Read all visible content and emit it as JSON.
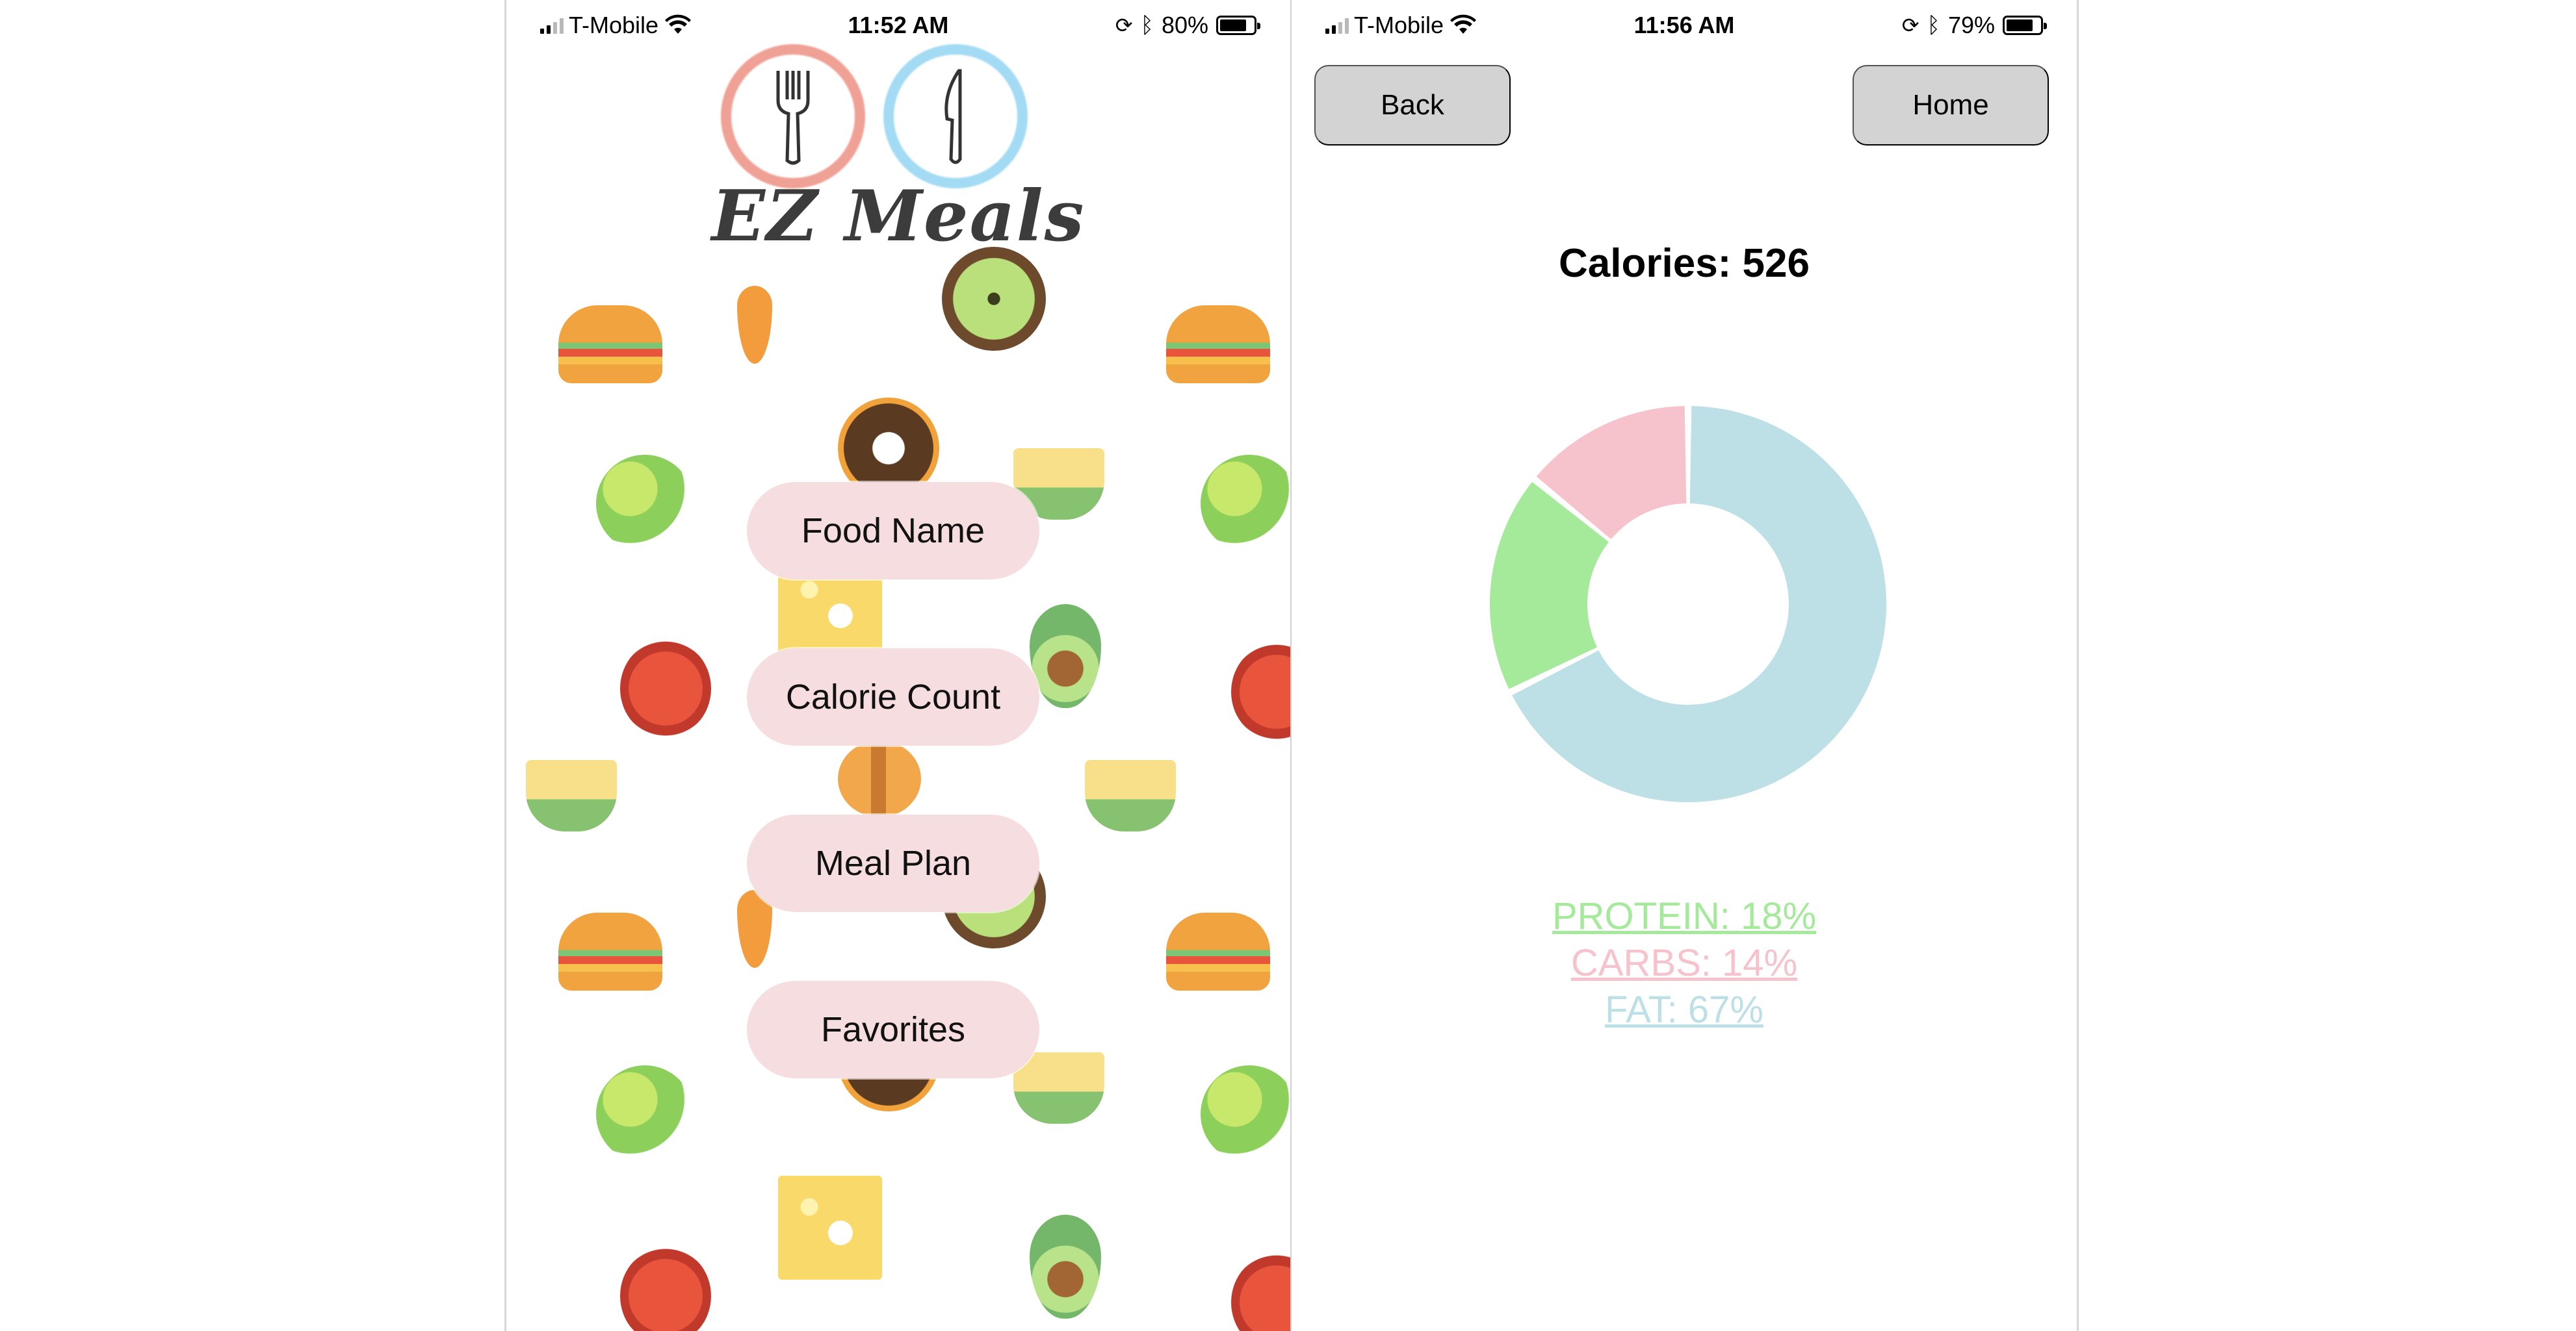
{
  "left_screen": {
    "status": {
      "carrier": "T-Mobile",
      "time": "11:52 AM",
      "battery": "80%",
      "battery_fraction": 0.8
    },
    "logo": {
      "text": "EZ Meals"
    },
    "menu": [
      {
        "label": "Food Name"
      },
      {
        "label": "Calorie Count"
      },
      {
        "label": "Meal Plan"
      },
      {
        "label": "Favorites"
      }
    ]
  },
  "right_screen": {
    "status": {
      "carrier": "T-Mobile",
      "time": "11:56 AM",
      "battery": "79%",
      "battery_fraction": 0.79
    },
    "nav": {
      "back_label": "Back",
      "home_label": "Home"
    },
    "calories_label": "Calories: 526",
    "legend": [
      {
        "text": "PROTEIN: 18%",
        "color": "#a5e99a"
      },
      {
        "text": "CARBS: 14%",
        "color": "#f6c3cc"
      },
      {
        "text": "FAT: 67%",
        "color": "#bddfe6"
      }
    ]
  },
  "chart_data": {
    "type": "pie",
    "categories": [
      "FAT",
      "PROTEIN",
      "CARBS"
    ],
    "values": [
      67,
      18,
      14
    ],
    "colors": [
      "#bddfe6",
      "#a5e99a",
      "#f6c3cc"
    ],
    "title": "",
    "legend": "bottom"
  }
}
